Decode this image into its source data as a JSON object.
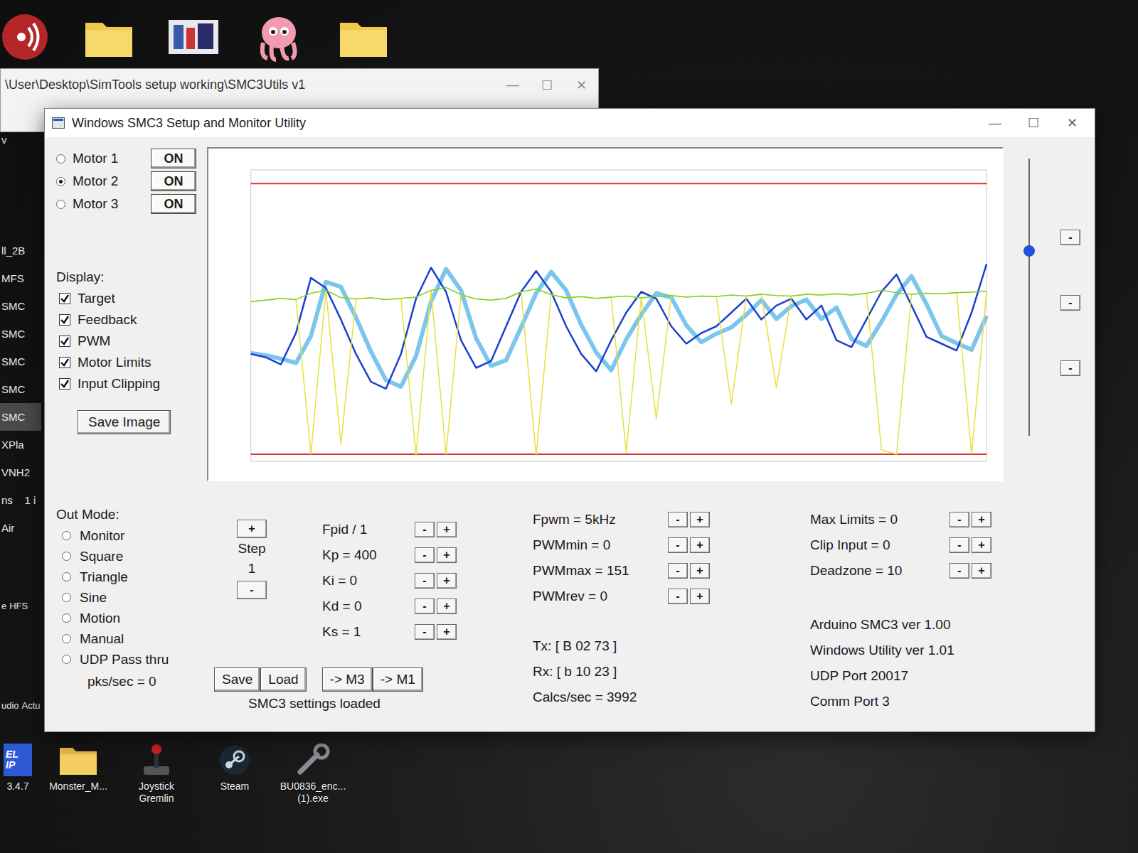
{
  "back_window": {
    "title": "\\User\\Desktop\\SimTools setup working\\SMC3Utils v1",
    "controls": [
      "—",
      "☐",
      "✕"
    ]
  },
  "desktop": {
    "corner_label": "v",
    "side_labels": [
      "ll_2B",
      "MFS",
      "SMC",
      "SMC",
      "SMC",
      "SMC",
      "SMC",
      "XPla",
      "VNH2",
      "ns    1 i",
      "Air"
    ],
    "side_selected": 6,
    "lower_labels": [
      [
        "e",
        "HFS"
      ],
      [
        "udio",
        "Actu"
      ]
    ],
    "bottom_icons": [
      {
        "label": "3.4.7",
        "badge": [
          "EL",
          "IP"
        ]
      },
      {
        "label": "Monster_M...",
        "badge": []
      },
      {
        "label": "Joystick Gremlin",
        "badge": []
      },
      {
        "label": "Steam",
        "badge": []
      },
      {
        "label": "BU0836_enc... (1).exe",
        "badge": []
      }
    ]
  },
  "window": {
    "title": "Windows SMC3 Setup and Monitor Utility",
    "controls": [
      "—",
      "☐",
      "✕"
    ]
  },
  "motors": [
    {
      "label": "Motor 1",
      "selected": false,
      "button": "ON",
      "on": true
    },
    {
      "label": "Motor 2",
      "selected": true,
      "button": "ON",
      "on": true
    },
    {
      "label": "Motor 3",
      "selected": false,
      "button": "ON",
      "on": true
    }
  ],
  "display": {
    "label": "Display:",
    "items": [
      {
        "label": "Target",
        "checked": true
      },
      {
        "label": "Feedback",
        "checked": true
      },
      {
        "label": "PWM",
        "checked": true
      },
      {
        "label": "Motor Limits",
        "checked": true
      },
      {
        "label": "Input Clipping",
        "checked": true
      }
    ],
    "save_button": "Save Image"
  },
  "chart": {
    "limits": {
      "low": 25,
      "high": 975,
      "color": "#e03030"
    },
    "series": [
      {
        "kind": "halo",
        "color": "#7cc6ee",
        "values": [
          380,
          372,
          360,
          345,
          440,
          630,
          612,
          505,
          385,
          285,
          262,
          370,
          560,
          675,
          600,
          432,
          335,
          355,
          470,
          590,
          665,
          600,
          480,
          382,
          320,
          428,
          515,
          590,
          575,
          478,
          418,
          448,
          470,
          515,
          566,
          500,
          545,
          568,
          500,
          540,
          430,
          405,
          490,
          585,
          650,
          552,
          440,
          415,
          392,
          510
        ]
      },
      {
        "kind": "line",
        "color": "#1c3fd0",
        "values": [
          377,
          365,
          340,
          450,
          644,
          608,
          498,
          377,
          279,
          255,
          377,
          571,
          680,
          595,
          425,
          328,
          352,
          474,
          595,
          668,
          595,
          474,
          377,
          316,
          425,
          522,
          595,
          571,
          474,
          413,
          450,
          474,
          522,
          571,
          498,
          547,
          571,
          498,
          547,
          425,
          401,
          498,
          595,
          656,
          547,
          437,
          413,
          389,
          522,
          693
        ]
      },
      {
        "kind": "spike",
        "color": "#e6e03a",
        "values": [
          560,
          566,
          572,
          568,
          25,
          600,
          60,
          570,
          574,
          568,
          572,
          20,
          600,
          25,
          585,
          570,
          566,
          572,
          595,
          20,
          585,
          574,
          578,
          572,
          576,
          30,
          574,
          150,
          582,
          576,
          580,
          578,
          200,
          580,
          586,
          260,
          580,
          586,
          584,
          588,
          584,
          590,
          40,
          25,
          586,
          590,
          588,
          592,
          25,
          596
        ]
      },
      {
        "kind": "thin",
        "color": "#7ed321",
        "values": [
          560,
          566,
          572,
          568,
          590,
          600,
          575,
          570,
          574,
          568,
          572,
          576,
          600,
          610,
          585,
          570,
          566,
          572,
          595,
          605,
          585,
          574,
          578,
          572,
          576,
          580,
          574,
          578,
          582,
          576,
          580,
          578,
          584,
          580,
          586,
          582,
          580,
          586,
          584,
          588,
          584,
          590,
          600,
          592,
          586,
          590,
          588,
          592,
          594,
          596
        ]
      }
    ]
  },
  "slider": {
    "level": 0.67,
    "buttons": [
      "-",
      "-",
      "-"
    ]
  },
  "out_mode": {
    "label": "Out Mode:",
    "options": [
      {
        "label": "Monitor",
        "selected": false
      },
      {
        "label": "Square",
        "selected": false
      },
      {
        "label": "Triangle",
        "selected": false
      },
      {
        "label": "Sine",
        "selected": false
      },
      {
        "label": "Motion",
        "selected": false
      },
      {
        "label": "Manual",
        "selected": false
      },
      {
        "label": "UDP Pass thru",
        "selected": false
      }
    ],
    "rate": "pks/sec = 0"
  },
  "step": {
    "inc": "+",
    "label": "Step",
    "value": "1",
    "dec": "-"
  },
  "pid": [
    {
      "label": "Fpid / 1",
      "dec": "-",
      "inc": "+"
    },
    {
      "label": "Kp = 400",
      "dec": "-",
      "inc": "+"
    },
    {
      "label": "Ki = 0",
      "dec": "-",
      "inc": "+"
    },
    {
      "label": "Kd = 0",
      "dec": "-",
      "inc": "+"
    },
    {
      "label": "Ks = 1",
      "dec": "-",
      "inc": "+"
    }
  ],
  "pwm": [
    {
      "label": "Fpwm = 5kHz",
      "dec": "-",
      "inc": "+"
    },
    {
      "label": "PWMmin = 0",
      "dec": "-",
      "inc": "+"
    },
    {
      "label": "PWMmax = 151",
      "dec": "-",
      "inc": "+"
    },
    {
      "label": "PWMrev = 0",
      "dec": "-",
      "inc": "+"
    }
  ],
  "limits": [
    {
      "label": "Max Limits = 0",
      "dec": "-",
      "inc": "+"
    },
    {
      "label": "Clip Input = 0",
      "dec": "-",
      "inc": "+"
    },
    {
      "label": "Deadzone = 10",
      "dec": "-",
      "inc": "+"
    }
  ],
  "actions": [
    [
      "Save",
      "Load"
    ],
    [
      "-> M3",
      "-> M1"
    ]
  ],
  "status": "SMC3 settings loaded",
  "comms": [
    "Tx: [ B 02 73 ]",
    "Rx: [ b 10 23 ]",
    "Calcs/sec = 3992"
  ],
  "info": [
    "Arduino SMC3 ver 1.00",
    "Windows Utility ver 1.01",
    "UDP Port 20017",
    "Comm Port 3"
  ]
}
